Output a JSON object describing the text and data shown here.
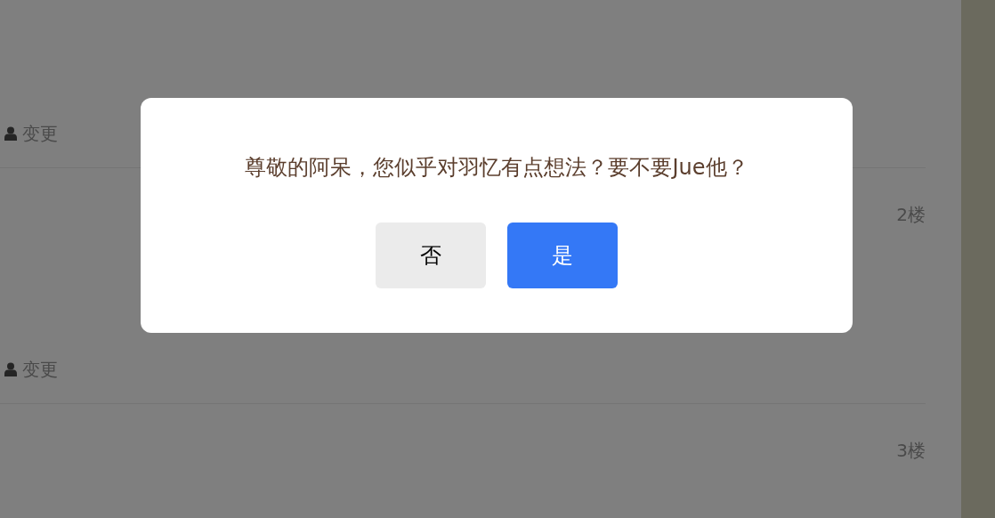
{
  "posts": [
    {
      "footer_action": "变更"
    },
    {
      "floor": "2楼",
      "footer_action": "变更"
    },
    {
      "floor": "3楼"
    }
  ],
  "dialog": {
    "message": "尊敬的阿呆，您似乎对羽忆有点想法？要不要Jue他？",
    "buttons": [
      {
        "label": "否",
        "kind": "secondary"
      },
      {
        "label": "是",
        "kind": "primary"
      }
    ]
  }
}
